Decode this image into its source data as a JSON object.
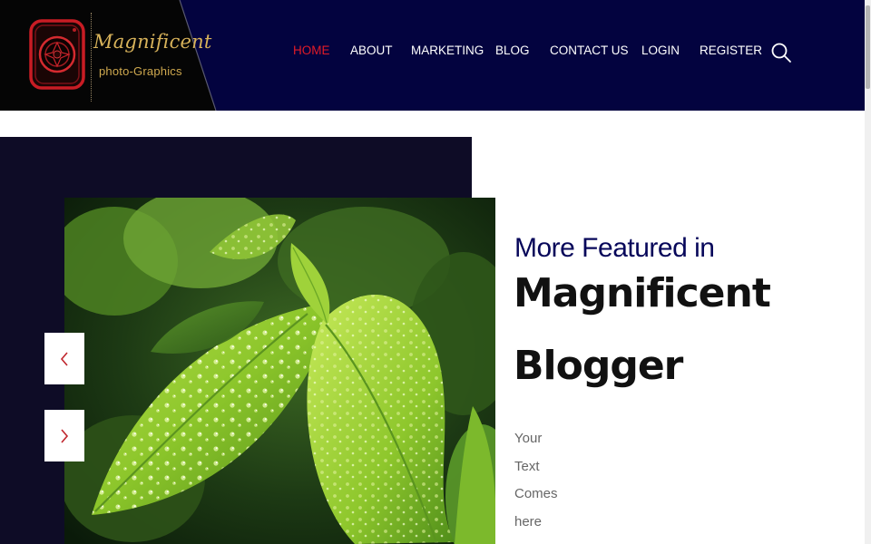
{
  "brand": {
    "name": "Magnificent",
    "tagline": "photo-Graphics",
    "colors": {
      "header_bg": "#03033f",
      "accent_red": "#e21b27",
      "heading_navy": "#07075a",
      "hero_panel": "#0e0c26"
    }
  },
  "nav": {
    "items": [
      {
        "label": "HOME",
        "active": true
      },
      {
        "label": "ABOUT",
        "active": false
      },
      {
        "label": "MARKETING",
        "active": false
      },
      {
        "label": "BLOG",
        "active": false
      },
      {
        "label": "CONTACT US",
        "active": false
      },
      {
        "label": "LOGIN",
        "active": false
      },
      {
        "label": "REGISTER",
        "active": false
      }
    ],
    "search_icon": "search-icon"
  },
  "hero": {
    "image_subject": "green leaves with water droplets",
    "prev_icon": "chevron-left-icon",
    "next_icon": "chevron-right-icon"
  },
  "featured": {
    "kicker": "More Featured in",
    "title_line1": "Magnificent",
    "title_line2": "Blogger",
    "body_words": [
      "Your",
      "Text",
      "Comes",
      "here"
    ]
  }
}
